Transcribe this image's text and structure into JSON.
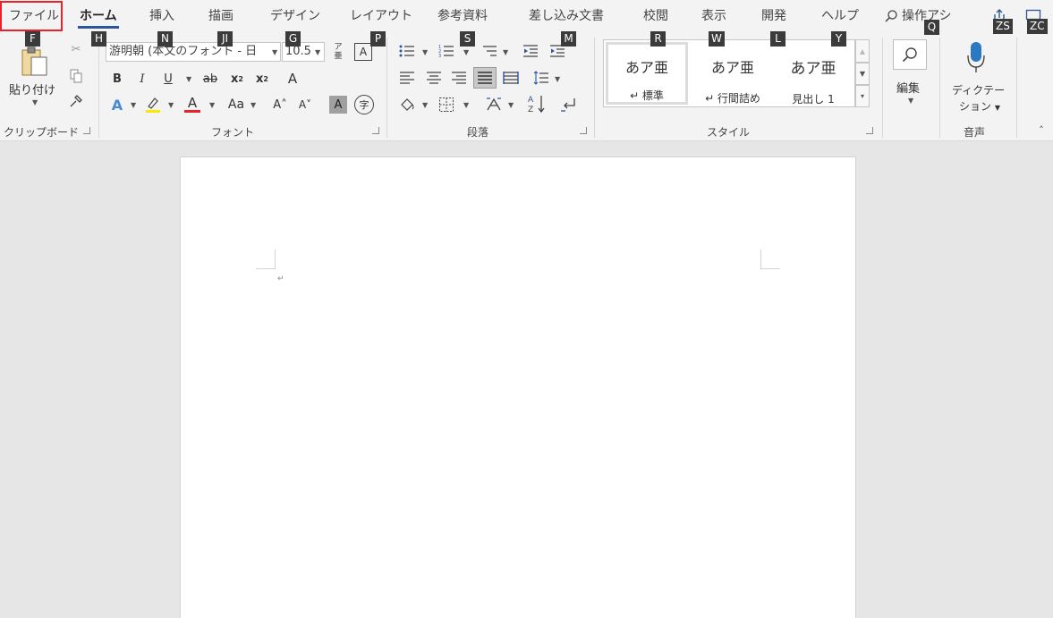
{
  "tabs": {
    "file": "ファイル",
    "home": "ホーム",
    "insert": "挿入",
    "draw": "描画",
    "design": "デザイン",
    "layout": "レイアウト",
    "references": "参考資料",
    "mailings": "差し込み文書",
    "review": "校閲",
    "view": "表示",
    "developer": "開発",
    "help": "ヘルプ",
    "tell_me": "操作アシ"
  },
  "keytips": {
    "file": "F",
    "home": "H",
    "insert": "N",
    "draw": "JI",
    "design": "G",
    "layout": "P",
    "references": "S",
    "mailings": "M",
    "review": "R",
    "view": "W",
    "developer": "L",
    "help": "Y",
    "tell_me": "Q",
    "share": "ZS",
    "comments": "ZC"
  },
  "clipboard": {
    "paste_label": "貼り付け",
    "group_label": "クリップボード"
  },
  "font": {
    "font_name": "游明朝 (本文のフォント - 日",
    "font_size": "10.5",
    "group_label": "フォント",
    "change_case": "Aa"
  },
  "paragraph": {
    "group_label": "段落"
  },
  "styles": {
    "items": [
      {
        "preview": "あア亜",
        "name": "↵ 標準"
      },
      {
        "preview": "あア亜",
        "name": "↵ 行間詰め"
      },
      {
        "preview": "あア亜",
        "name": "見出し 1"
      }
    ],
    "group_label": "スタイル"
  },
  "editing": {
    "label": "編集"
  },
  "voice": {
    "dictate_line1": "ディクテー",
    "dictate_line2": "ション",
    "group_label": "音声"
  },
  "colors": {
    "accent": "#2b579a",
    "highlight_box": "#e8222a",
    "font_color": "#e8222a",
    "highlighter": "#ffe600"
  }
}
